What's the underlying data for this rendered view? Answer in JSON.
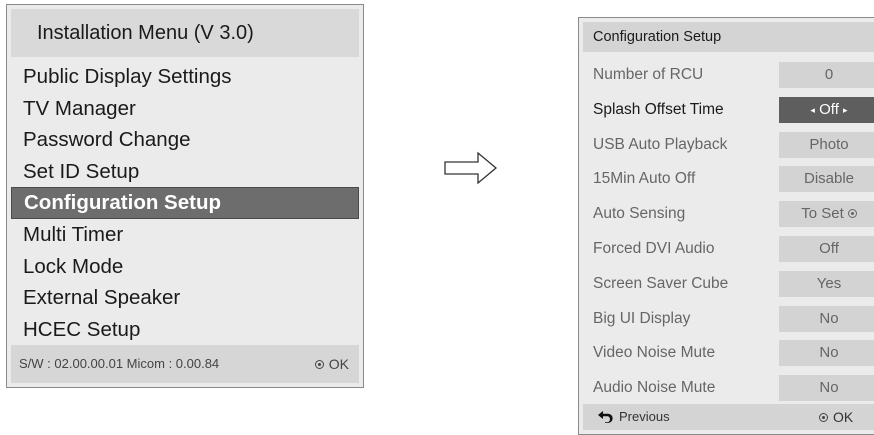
{
  "installation_menu": {
    "title": "Installation Menu (V 3.0)",
    "items": [
      {
        "label": "Public Display Settings"
      },
      {
        "label": "TV Manager"
      },
      {
        "label": "Password Change"
      },
      {
        "label": "Set ID Setup"
      },
      {
        "label": "Configuration Setup",
        "selected": true
      },
      {
        "label": "Multi Timer"
      },
      {
        "label": "Lock Mode"
      },
      {
        "label": "External Speaker"
      },
      {
        "label": "HCEC Setup"
      }
    ],
    "footer": {
      "version_text": "S/W : 02.00.00.01 Micom : 0.00.84",
      "ok_label": "OK",
      "ok_icon": "ok-button-icon"
    }
  },
  "transition_icon": "right-arrow-icon",
  "configuration_setup": {
    "title": "Configuration Setup",
    "rows": [
      {
        "label": "Number of RCU",
        "value": "0"
      },
      {
        "label": "Splash Offset Time",
        "value": "Off",
        "selected": true,
        "left_arrow": "◂",
        "right_arrow": "▸"
      },
      {
        "label": "USB Auto Playback",
        "value": "Photo"
      },
      {
        "label": "15Min Auto Off",
        "value": "Disable"
      },
      {
        "label": "Auto Sensing",
        "value": "To Set",
        "icon": "ok-button-icon"
      },
      {
        "label": "Forced DVI Audio",
        "value": "Off"
      },
      {
        "label": "Screen Saver Cube",
        "value": "Yes"
      },
      {
        "label": "Big UI Display",
        "value": "No"
      },
      {
        "label": "Video Noise Mute",
        "value": "No"
      },
      {
        "label": "Audio Noise Mute",
        "value": "No"
      }
    ],
    "footer": {
      "previous_label": "Previous",
      "previous_icon": "back-arrow-icon",
      "ok_label": "OK",
      "ok_icon": "ok-button-icon"
    }
  },
  "colors": {
    "panel_bg": "#ebebeb",
    "selected_bg": "#6d6d6d",
    "value_bg": "#d3d3d3"
  }
}
